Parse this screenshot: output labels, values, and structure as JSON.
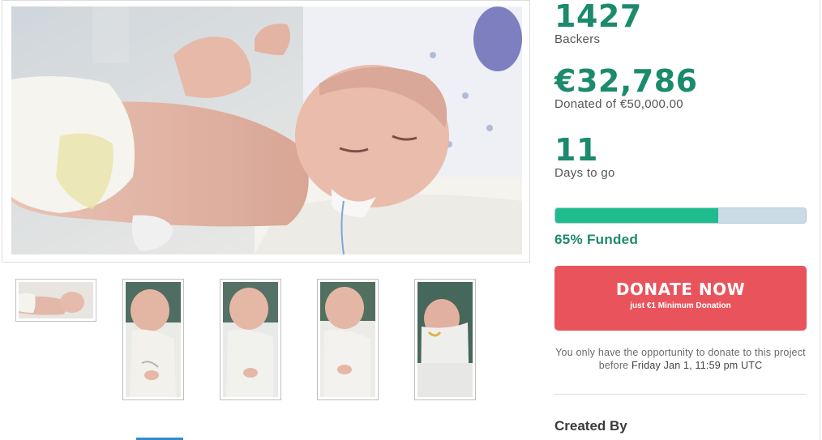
{
  "stats": {
    "backers_value": "1427",
    "backers_label": "Backers",
    "donated_value": "€32,786",
    "donated_label": "Donated of €50,000.00",
    "days_value": "11",
    "days_label": "Days to go"
  },
  "progress": {
    "fraction": 0.65,
    "funded_label": "65% Funded"
  },
  "donate": {
    "label": "DONATE NOW",
    "sublabel": "just €1 Minimum Donation"
  },
  "deadline": {
    "prefix": "You only have the opportunity to donate to this project before",
    "date": "Friday Jan 1, 11:59 pm UTC"
  },
  "created_by": "Created By",
  "colors": {
    "accent_green": "#1c8a6c",
    "progress_fill": "#1fbc8e",
    "donate_red": "#e9545c"
  }
}
